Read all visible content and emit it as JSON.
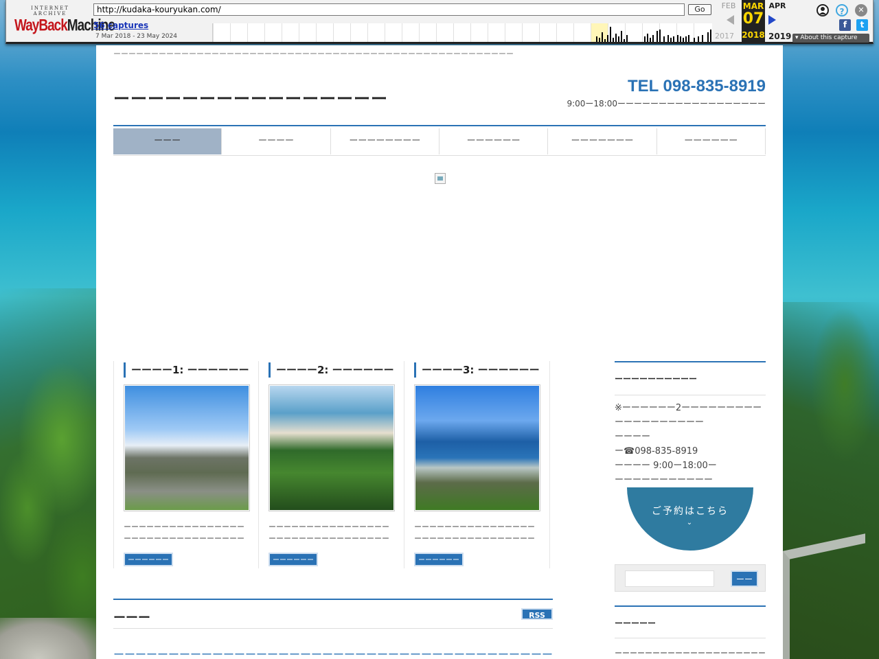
{
  "wayback": {
    "logo_top": "INTERNET ARCHIVE",
    "logo_main_red": "WayBack",
    "logo_main_dark": "Machine",
    "url": "http://kudaka-kouryukan.com/",
    "go_label": "Go",
    "captures": "56 captures",
    "date_range": "7 Mar 2018 - 23 May 2024",
    "prev_month": "FEB",
    "prev_year": "2017",
    "cur_month": "MAR",
    "cur_day": "07",
    "cur_year": "2018",
    "next_month": "APR",
    "next_year": "2019",
    "about": "About this capture",
    "help_glyph": "?",
    "close_glyph": "✕",
    "facebook_glyph": "f",
    "twitter_glyph": "t"
  },
  "header": {
    "tagline": "ーーーーーーーーーーーーーーーーーーーーーーーーーーーーーーーーーーーーーーーーーーーーーーーーーーーーー",
    "site_title": "ーーーーーーーーーーーーーーーー",
    "tel": "TEL 098-835-8919",
    "hours": "9:00ー18:00ーーーーーーーーーーーーーーーーーー"
  },
  "nav": {
    "items": [
      {
        "label": "ーーー"
      },
      {
        "label": "ーーーー"
      },
      {
        "label": "ーーーーーーーー"
      },
      {
        "label": "ーーーーーー"
      },
      {
        "label": "ーーーーーーー"
      },
      {
        "label": "ーーーーーー"
      }
    ]
  },
  "features": [
    {
      "title": "ーーーー1: ーーーーーーーーーーーー",
      "text": "ーーーーーーーーーーーーーーーーーーーーーーーーーーーーーーーーーーーーーーーーーーーーーーーーー",
      "more": "ーーーーーーー"
    },
    {
      "title": "ーーーー2: ーーーーーーーーーーーー",
      "text": "ーーーーーーーーーーーーーーーーーーーーーーーーーーーーーーーーーーーーーーーーーーーーーーーーーーー",
      "more": "ーーーーーーー"
    },
    {
      "title": "ーーーー3: ーーーーーーーーーーーー",
      "text": "ーーーーーーーーーーーーーーーーーーーーーーーーーーーーーーーーー",
      "more": "ーーーーーーー"
    }
  ],
  "news": {
    "heading": "ーーー",
    "rss": "RSS",
    "link": "ーーーーーーーーーーーーーーーーーーーーーーーーーーーーーーーーーーーーーーーーーーーーーーーーーーーーーーーーー"
  },
  "sidebar": {
    "contact_heading": "ーーーーーーーーーー",
    "contact_lines": [
      "※ーーーーーー2ーーーーーーーーーーーーーーーーーーー",
      "ーーーー",
      "ー☎098-835-8919",
      "ーーーー 9:00ー18:00ー",
      "ーーーーーーーーーーー"
    ],
    "reserve_label": "ご予約はこちら",
    "reserve_chevron": "⌄",
    "search_placeholder": "",
    "search_button": "ーー",
    "about_heading": "ーーーーー",
    "about_text": "ーーーーーーーーーーーーーーーーーーーーーーーーーーーーーーーーーーーーーーーーーーーーーーーーー"
  },
  "colors": {
    "accent": "#2a72b5",
    "nav_active": "#a0b2c6",
    "reserve": "#2f7ba0"
  }
}
